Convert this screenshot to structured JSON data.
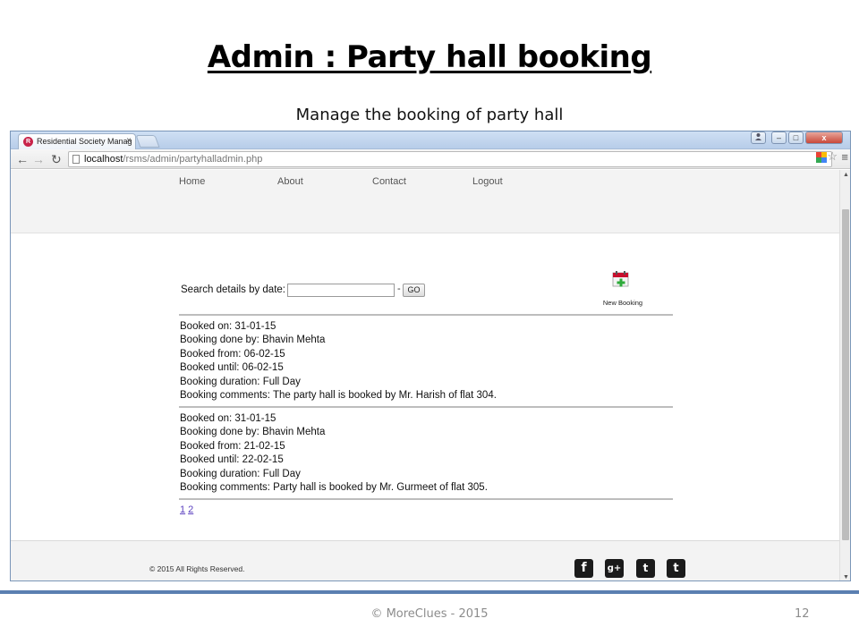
{
  "slide": {
    "title": "Admin : Party hall booking",
    "subtitle": "Manage the booking of party hall",
    "footer": "© MoreClues - 2015",
    "page_number": "12"
  },
  "browser": {
    "tab_title": "Residential Society Manag",
    "tab_close": "×",
    "url_host": "localhost",
    "url_path": "/rsms/admin/partyhalladmin.php",
    "window_controls": {
      "minimize": "–",
      "maximize": "□",
      "close": "x"
    },
    "icons": [
      "back-arrow-icon",
      "forward-arrow-icon",
      "reload-icon",
      "page-icon",
      "extension-icon",
      "star-icon",
      "menu-icon"
    ]
  },
  "site": {
    "nav": [
      "Home",
      "About",
      "Contact",
      "Logout"
    ],
    "search": {
      "label": "Search details by date:",
      "value": "",
      "dash": "-",
      "button": "GO"
    },
    "new_booking_label": "New Booking",
    "bookings": [
      {
        "booked_on": "Booked on: 31-01-15",
        "booked_by": "Booking done by: Bhavin Mehta",
        "from": "Booked from: 06-02-15",
        "until": "Booked until: 06-02-15",
        "duration": "Booking duration: Full Day",
        "comments": "Booking comments: The party hall is booked by Mr. Harish of flat 304."
      },
      {
        "booked_on": "Booked on: 31-01-15",
        "booked_by": "Booking done by: Bhavin Mehta",
        "from": "Booked from: 21-02-15",
        "until": "Booked until: 22-02-15",
        "duration": "Booking duration: Full Day",
        "comments": "Booking comments: Party hall is booked by Mr. Gurmeet of flat 305."
      }
    ],
    "pages": [
      "1",
      "2"
    ],
    "copyright": "© 2015 All Rights Reserved.",
    "social": [
      {
        "name": "facebook",
        "glyph": "f"
      },
      {
        "name": "google-plus",
        "glyph": "g+"
      },
      {
        "name": "twitter",
        "glyph": "t"
      },
      {
        "name": "tumblr",
        "glyph": "t"
      }
    ]
  },
  "colors": {
    "link": "#5a3fbf",
    "slide_rule": "#5b7fb1",
    "header_bg": "#f3f3f3",
    "favicon": "#c8244b",
    "new_booking_icon": "#c8102e"
  }
}
